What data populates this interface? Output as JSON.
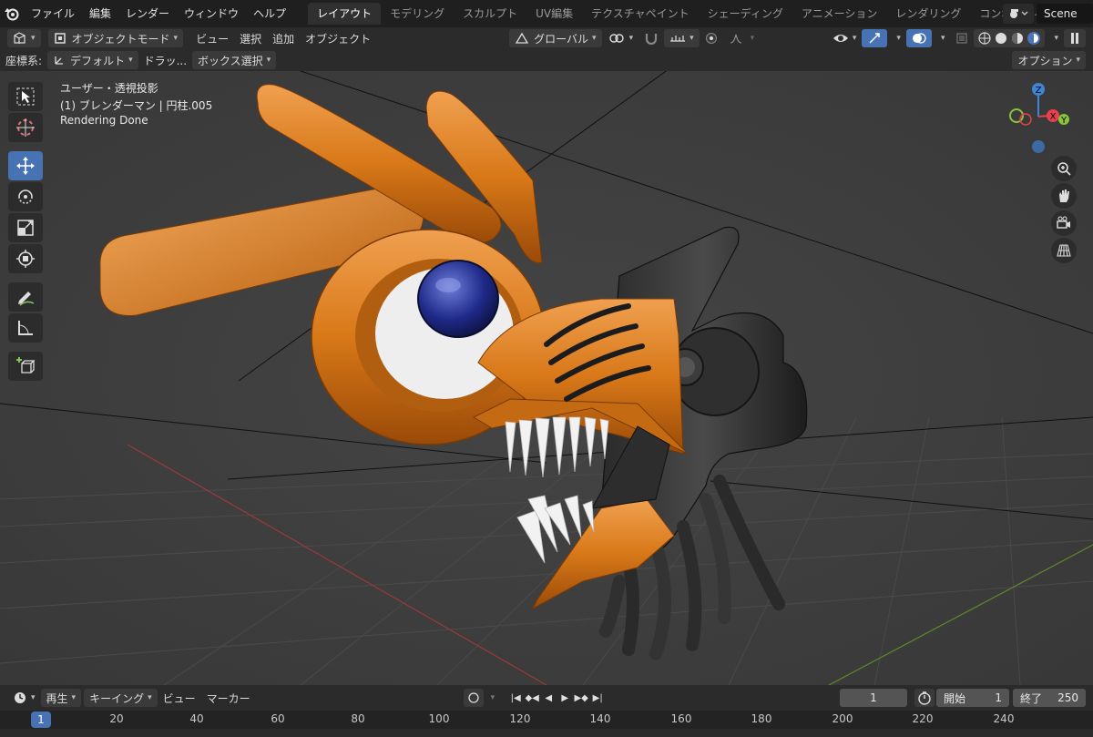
{
  "menubar": {
    "logo_icon": "blender-logo-icon",
    "menus": [
      "ファイル",
      "編集",
      "レンダー",
      "ウィンドウ",
      "ヘルプ"
    ],
    "workspaces": [
      "レイアウト",
      "モデリング",
      "スカルプト",
      "UV編集",
      "テクスチャペイント",
      "シェーディング",
      "アニメーション",
      "レンダリング",
      "コンポジティング"
    ],
    "active_workspace": "レイアウト",
    "scene_name": "Scene"
  },
  "header": {
    "mode": "オブジェクトモード",
    "menus": [
      "ビュー",
      "選択",
      "追加",
      "オブジェクト"
    ],
    "transform_orientation": "グローバル",
    "coord_label": "座標系:",
    "coord_value": "デフォルト",
    "drag_label": "ドラッ...",
    "select_mode": "ボックス選択",
    "options": "オプション"
  },
  "viewport": {
    "view_name": "ユーザー・透視投影",
    "object_info": "(1) ブレンダーマン | 円柱.005",
    "status": "Rendering Done",
    "accent_color": "#4772b3",
    "axis_x_color": "#e8414e",
    "axis_y_color": "#8ac33c",
    "axis_z_color": "#3d85d6",
    "gizmo_labels": {
      "z": "Z",
      "y": "Y",
      "x": "X"
    },
    "tools": [
      "select-box-icon",
      "cursor-icon",
      "move-icon",
      "rotate-icon",
      "scale-icon",
      "transform-icon",
      "annotate-icon",
      "measure-icon",
      "add-cube-icon"
    ],
    "active_tool": "move-icon"
  },
  "timeline": {
    "menus": [
      "再生",
      "キーイング",
      "ビュー",
      "マーカー"
    ],
    "current_frame": "1",
    "start_label": "開始",
    "start_value": "1",
    "end_label": "終了",
    "end_value": "250",
    "ruler": [
      "20",
      "40",
      "60",
      "80",
      "100",
      "120",
      "140",
      "160",
      "180",
      "200",
      "220",
      "240"
    ]
  }
}
